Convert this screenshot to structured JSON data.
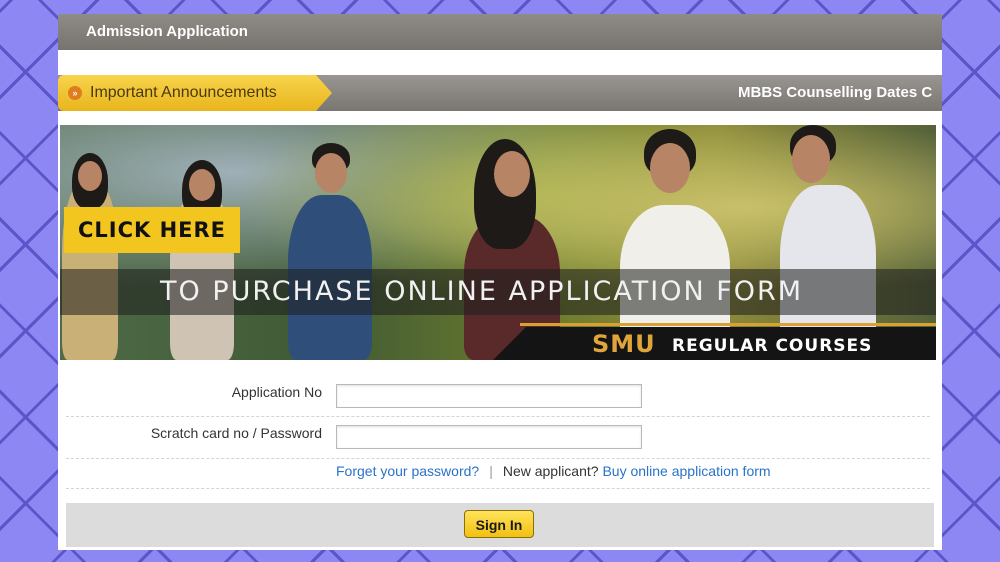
{
  "header": {
    "title": "Admission Application"
  },
  "announcements": {
    "label": "Important Announcements",
    "icon": "double-chevron-right-icon",
    "ticker": "MBBS Counselling Dates C"
  },
  "banner": {
    "click_here": "CLICK HERE",
    "headline": "TO PURCHASE ONLINE APPLICATION FORM",
    "brand": "SMU",
    "subtitle": "REGULAR COURSES"
  },
  "form": {
    "application_no_label": "Application No",
    "application_no_value": "",
    "password_label": "Scratch card no / Password",
    "password_value": "",
    "forgot_password": "Forget your password?",
    "separator": "|",
    "new_applicant": "New applicant?",
    "buy_form": "Buy online application form",
    "sign_in": "Sign In"
  },
  "colors": {
    "background": "#8c87f2",
    "accent": "#f3c51f",
    "link": "#2a72c9",
    "brand": "#e0a53a"
  }
}
